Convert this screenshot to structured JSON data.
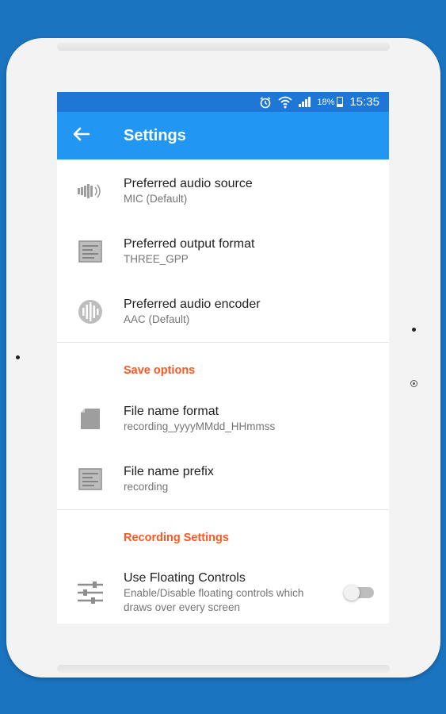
{
  "status_bar": {
    "battery_percent": "18%",
    "time": "15:35"
  },
  "appbar": {
    "back_icon": "arrow-left-icon",
    "title": "Settings"
  },
  "audio_settings": [
    {
      "title": "Preferred audio source",
      "value": "MIC (Default)",
      "icon": "speaker-icon"
    },
    {
      "title": "Preferred output format",
      "value": "THREE_GPP",
      "icon": "document-list-icon"
    },
    {
      "title": "Preferred audio encoder",
      "value": "AAC (Default)",
      "icon": "waveform-icon"
    }
  ],
  "save_options": {
    "header": "Save options",
    "items": [
      {
        "title": "File name format",
        "value": "recording_yyyyMMdd_HHmmss",
        "icon": "file-icon"
      },
      {
        "title": "File name prefix",
        "value": "recording",
        "icon": "document-list-icon"
      }
    ]
  },
  "recording_settings": {
    "header": "Recording Settings",
    "floating_controls": {
      "title": "Use Floating Controls",
      "description": "Enable/Disable floating controls which draws over every screen",
      "icon": "sliders-icon",
      "enabled": false
    }
  },
  "colors": {
    "background": "#1b74c0",
    "status_bar": "#1e76d6",
    "app_bar": "#2196f3",
    "section_header": "#ff5722"
  }
}
